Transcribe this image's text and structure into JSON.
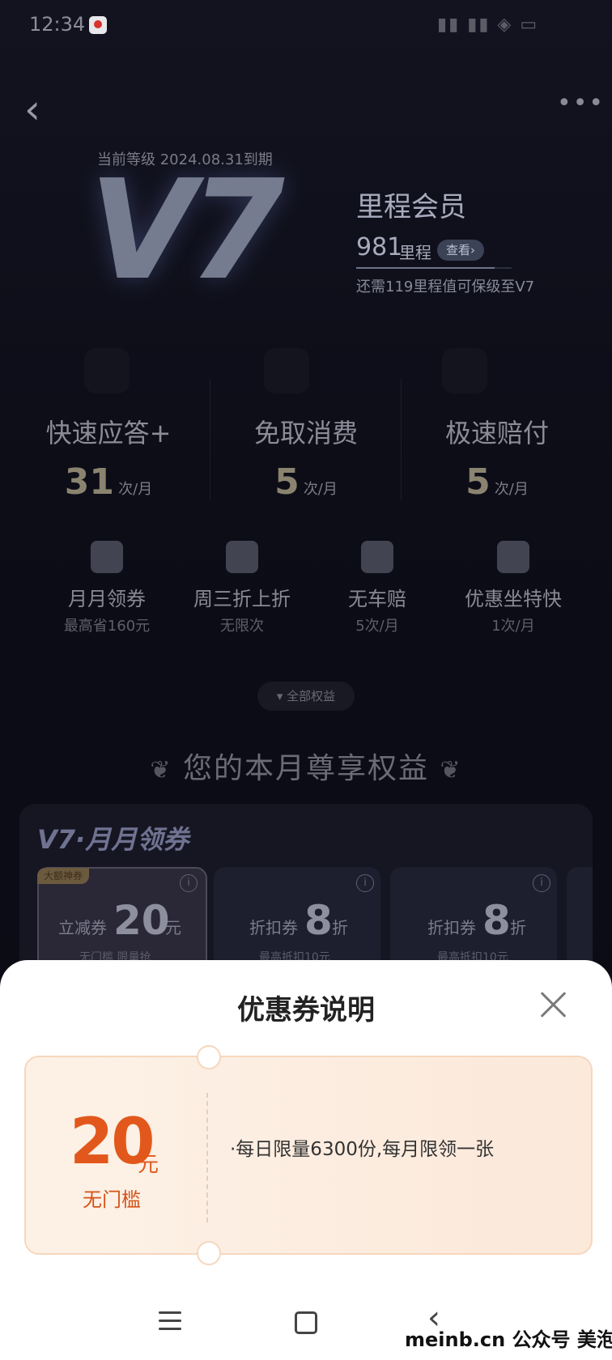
{
  "status_bar": {
    "time": "12:34",
    "right_icons": "▮▮ ▮▮ ◈ ▭"
  },
  "header": {
    "back_icon": "‹",
    "more_icon": "•••"
  },
  "level": {
    "label": "当前等级 2024.08.31到期",
    "badge": "V7",
    "member_name": "里程会员",
    "miles": "981",
    "miles_unit": "里程",
    "view_label": "查看›",
    "progress": 0.89,
    "upgrade_hint": "还需119里程值可保级至V7"
  },
  "benefits": [
    {
      "title": "快速应答+",
      "count": "31",
      "unit": "次/月"
    },
    {
      "title": "免取消费",
      "count": "5",
      "unit": "次/月"
    },
    {
      "title": "极速赔付",
      "count": "5",
      "unit": "次/月"
    }
  ],
  "perks": [
    {
      "title": "月月领券",
      "sub": "最高省160元",
      "icon": "gift-icon"
    },
    {
      "title": "周三折上折",
      "sub": "无限次",
      "icon": "discount-tag-icon"
    },
    {
      "title": "无车赔",
      "sub": "5次/月",
      "icon": "clock-history-icon"
    },
    {
      "title": "优惠坐特快",
      "sub": "1次/月",
      "icon": "rocket-icon"
    }
  ],
  "all_benefits_label": "全部权益",
  "month_section_title": "您的本月尊享权益",
  "coupon_section": {
    "title": "V7·月月领券",
    "cards": [
      {
        "badge": "大额神券",
        "type": "立减券",
        "value": "20",
        "unit": "元",
        "sub": "无门槛 限量抢"
      },
      {
        "type": "折扣券",
        "value": "8",
        "unit": "折",
        "sub": "最高抵扣10元"
      },
      {
        "type": "折扣券",
        "value": "8",
        "unit": "折",
        "sub": "最高抵扣10元"
      }
    ]
  },
  "sheet": {
    "title": "优惠券说明",
    "coupon": {
      "amount": "20",
      "unit": "元",
      "threshold": "无门槛"
    },
    "rule": "·每日限量6300份,每月限领一张"
  },
  "watermark": "meinb.cn  公众号 美泡君"
}
